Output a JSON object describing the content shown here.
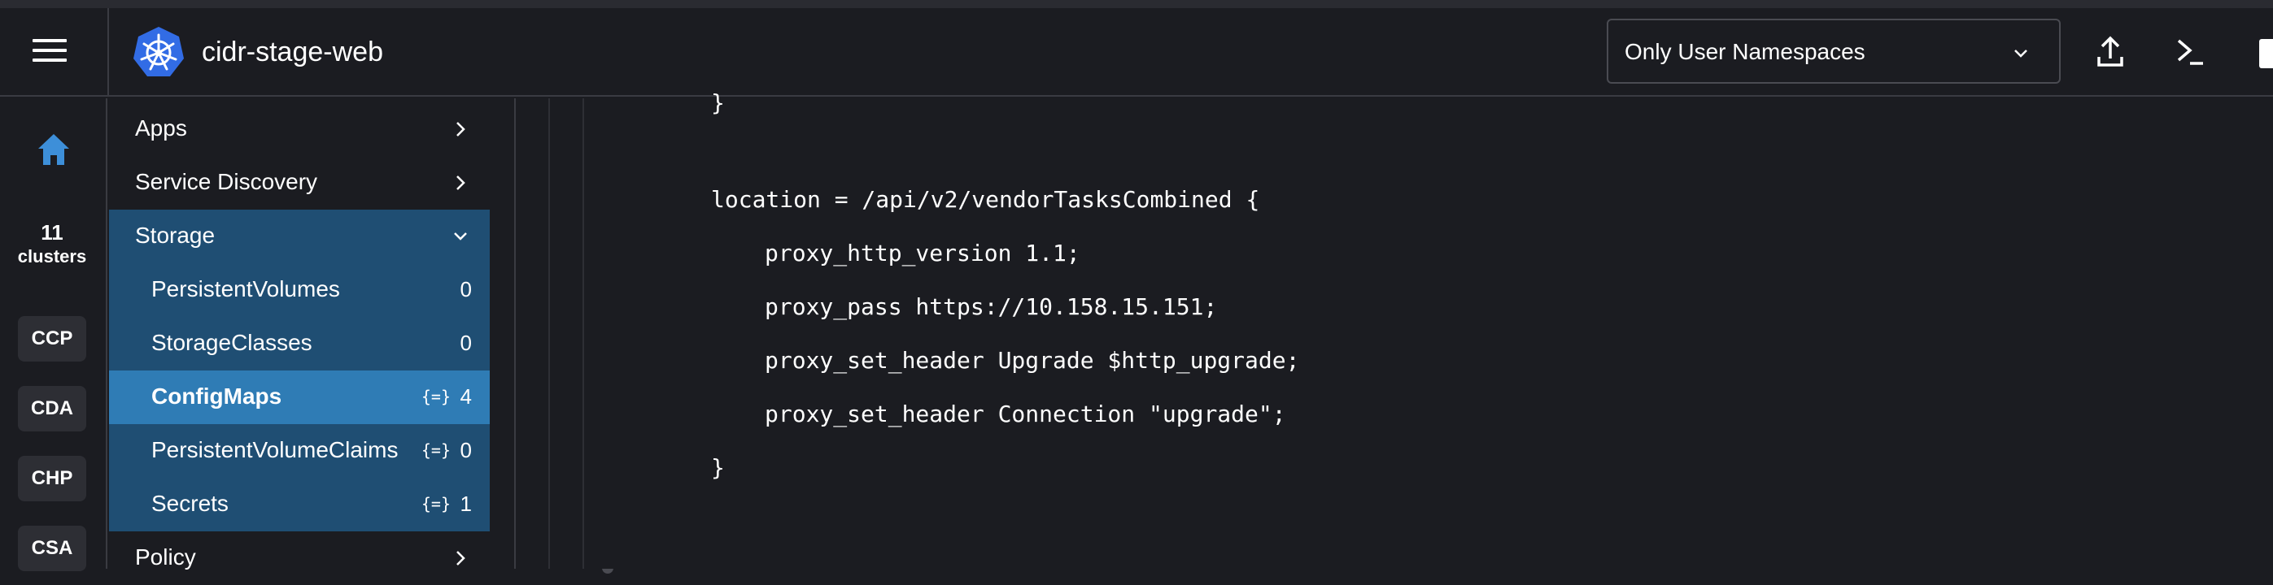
{
  "header": {
    "cluster_name": "cidr-stage-web",
    "namespace_filter": "Only User Namespaces",
    "menu_icon": "hamburger-menu-icon",
    "logo_icon": "kubernetes-logo-icon",
    "upload_icon": "upload-icon",
    "terminal_icon": "terminal-icon"
  },
  "rail": {
    "home_icon": "home-icon",
    "clusters_count": "11",
    "clusters_label": "clusters",
    "cluster_badges": [
      "CCP",
      "CDA",
      "CHP",
      "CSA"
    ]
  },
  "sidebar": {
    "items": [
      {
        "label": "Apps"
      },
      {
        "label": "Service Discovery"
      },
      {
        "label": "Storage"
      },
      {
        "label": "Policy"
      }
    ],
    "storage_children": [
      {
        "label": "PersistentVolumes",
        "count": "0"
      },
      {
        "label": "StorageClasses",
        "count": "0"
      },
      {
        "label": "ConfigMaps",
        "count": "4"
      },
      {
        "label": "PersistentVolumeClaims",
        "count": "0"
      },
      {
        "label": "Secrets",
        "count": "1"
      }
    ],
    "namespace_icon_glyph": "{=}"
  },
  "editor": {
    "lines": [
      "}",
      "location = /api/v2/vendorTasksCombined {",
      "proxy_http_version 1.1;",
      "proxy_pass https://10.158.15.151;",
      "proxy_set_header Upgrade $http_upgrade;",
      "proxy_set_header Connection \"upgrade\";",
      "}"
    ]
  },
  "colors": {
    "background": "#1b1c21",
    "sidebar_group": "#1f4e73",
    "sidebar_active": "#2f7cb5",
    "accent": "#3d8fd9"
  }
}
